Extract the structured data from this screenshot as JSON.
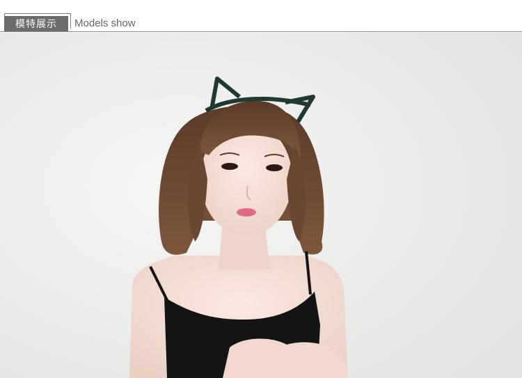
{
  "section_header": {
    "title_cn": "模特展示",
    "title_en": "Models show"
  },
  "photo": {
    "subject": "model-with-cat-ear-headband",
    "colors": {
      "background": "#eeefee",
      "hair": "#6b4a35",
      "headband": "#1e3a32",
      "top": "#141414",
      "skin": "#f3ddd2"
    }
  }
}
